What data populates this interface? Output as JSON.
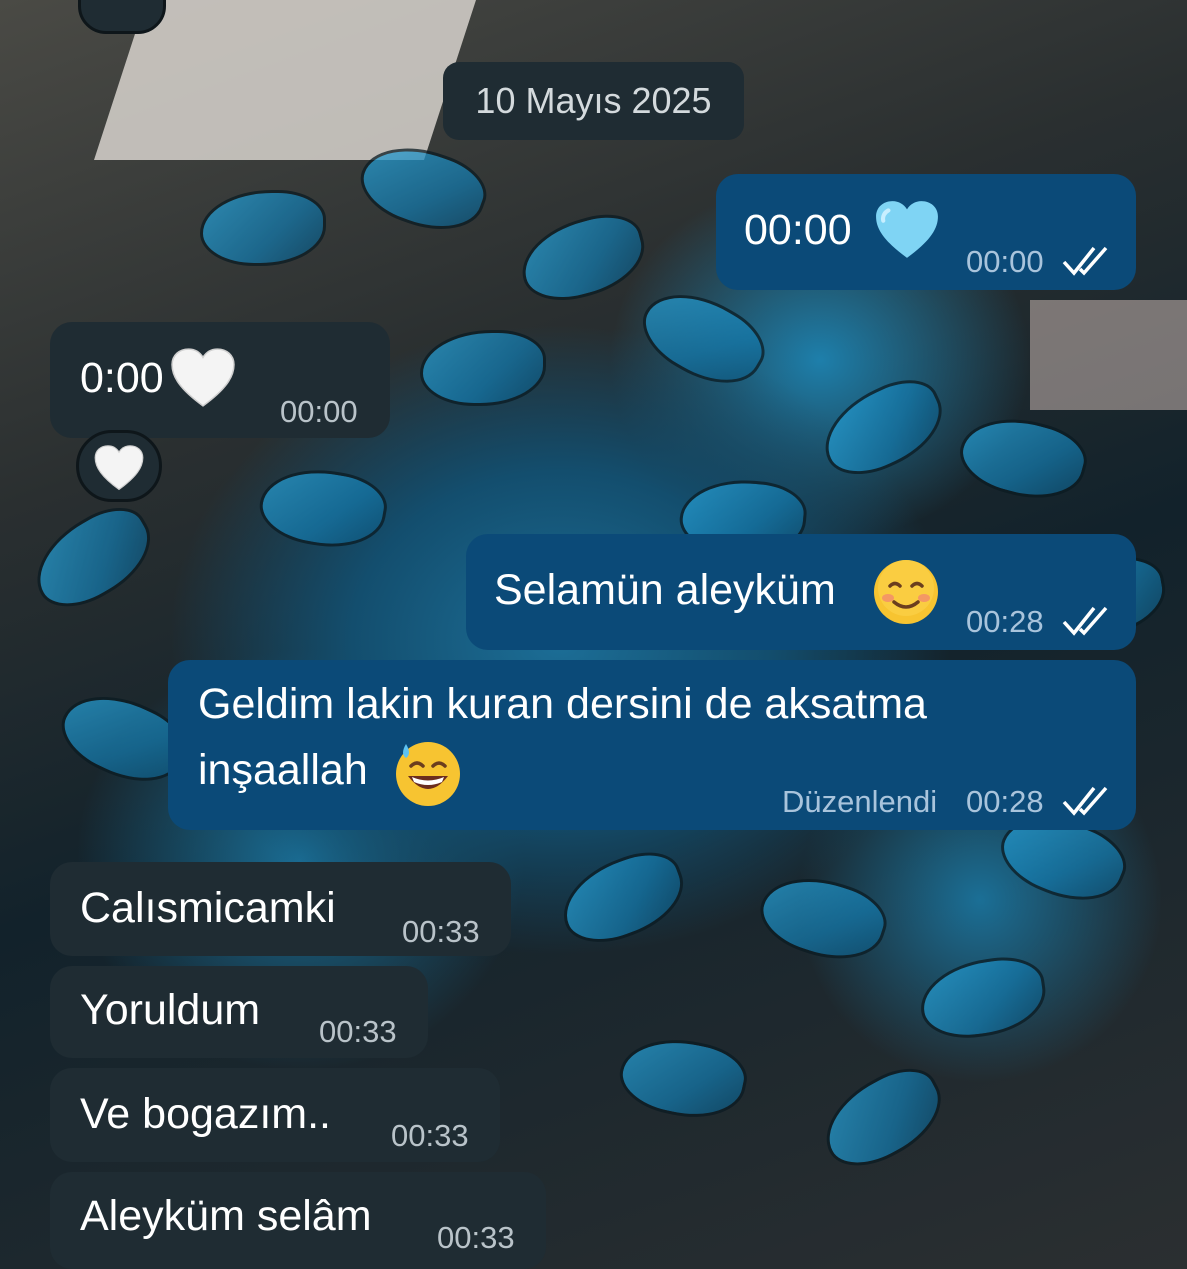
{
  "chat": {
    "date_separator": "10 Mayıs 2025",
    "messages": [
      {
        "dir": "out",
        "text": "00:00",
        "emoji": "light-blue-heart",
        "time": "00:00",
        "status": "read"
      },
      {
        "dir": "in",
        "text": "0:00",
        "emoji": "white-heart",
        "time": "00:00",
        "reaction": "white-heart"
      },
      {
        "dir": "out",
        "text": "Selamün aleyküm",
        "emoji": "smiling-face",
        "time": "00:28",
        "status": "read"
      },
      {
        "dir": "out",
        "text_line1": "Geldim lakin kuran dersini de aksatma",
        "text_line2": "inşaallah",
        "emoji": "grinning-sweat",
        "edited_label": "Düzenlendi",
        "time": "00:28",
        "status": "read"
      },
      {
        "dir": "in",
        "text": "Calısmicamki",
        "time": "00:33"
      },
      {
        "dir": "in",
        "text": "Yoruldum",
        "time": "00:33"
      },
      {
        "dir": "in",
        "text": "Ve bogazım..",
        "time": "00:33"
      },
      {
        "dir": "in",
        "text": "Aleyküm selâm",
        "time": "00:33"
      }
    ]
  },
  "colors": {
    "incoming_bubble": "#1f2c33",
    "outgoing_bubble": "#0b4a78",
    "read_ticks": "#ffffff"
  }
}
